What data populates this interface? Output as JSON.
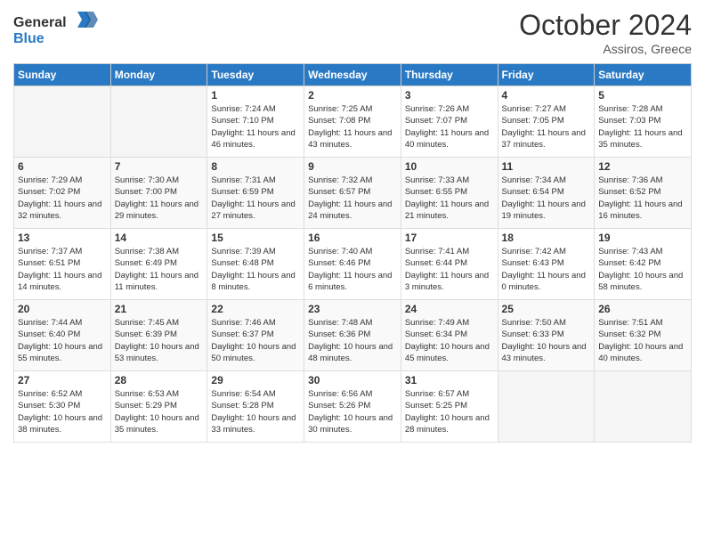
{
  "header": {
    "logo_line1": "General",
    "logo_line2": "Blue",
    "month": "October 2024",
    "location": "Assiros, Greece"
  },
  "weekdays": [
    "Sunday",
    "Monday",
    "Tuesday",
    "Wednesday",
    "Thursday",
    "Friday",
    "Saturday"
  ],
  "weeks": [
    [
      {
        "day": "",
        "info": ""
      },
      {
        "day": "",
        "info": ""
      },
      {
        "day": "1",
        "info": "Sunrise: 7:24 AM\nSunset: 7:10 PM\nDaylight: 11 hours and 46 minutes."
      },
      {
        "day": "2",
        "info": "Sunrise: 7:25 AM\nSunset: 7:08 PM\nDaylight: 11 hours and 43 minutes."
      },
      {
        "day": "3",
        "info": "Sunrise: 7:26 AM\nSunset: 7:07 PM\nDaylight: 11 hours and 40 minutes."
      },
      {
        "day": "4",
        "info": "Sunrise: 7:27 AM\nSunset: 7:05 PM\nDaylight: 11 hours and 37 minutes."
      },
      {
        "day": "5",
        "info": "Sunrise: 7:28 AM\nSunset: 7:03 PM\nDaylight: 11 hours and 35 minutes."
      }
    ],
    [
      {
        "day": "6",
        "info": "Sunrise: 7:29 AM\nSunset: 7:02 PM\nDaylight: 11 hours and 32 minutes."
      },
      {
        "day": "7",
        "info": "Sunrise: 7:30 AM\nSunset: 7:00 PM\nDaylight: 11 hours and 29 minutes."
      },
      {
        "day": "8",
        "info": "Sunrise: 7:31 AM\nSunset: 6:59 PM\nDaylight: 11 hours and 27 minutes."
      },
      {
        "day": "9",
        "info": "Sunrise: 7:32 AM\nSunset: 6:57 PM\nDaylight: 11 hours and 24 minutes."
      },
      {
        "day": "10",
        "info": "Sunrise: 7:33 AM\nSunset: 6:55 PM\nDaylight: 11 hours and 21 minutes."
      },
      {
        "day": "11",
        "info": "Sunrise: 7:34 AM\nSunset: 6:54 PM\nDaylight: 11 hours and 19 minutes."
      },
      {
        "day": "12",
        "info": "Sunrise: 7:36 AM\nSunset: 6:52 PM\nDaylight: 11 hours and 16 minutes."
      }
    ],
    [
      {
        "day": "13",
        "info": "Sunrise: 7:37 AM\nSunset: 6:51 PM\nDaylight: 11 hours and 14 minutes."
      },
      {
        "day": "14",
        "info": "Sunrise: 7:38 AM\nSunset: 6:49 PM\nDaylight: 11 hours and 11 minutes."
      },
      {
        "day": "15",
        "info": "Sunrise: 7:39 AM\nSunset: 6:48 PM\nDaylight: 11 hours and 8 minutes."
      },
      {
        "day": "16",
        "info": "Sunrise: 7:40 AM\nSunset: 6:46 PM\nDaylight: 11 hours and 6 minutes."
      },
      {
        "day": "17",
        "info": "Sunrise: 7:41 AM\nSunset: 6:44 PM\nDaylight: 11 hours and 3 minutes."
      },
      {
        "day": "18",
        "info": "Sunrise: 7:42 AM\nSunset: 6:43 PM\nDaylight: 11 hours and 0 minutes."
      },
      {
        "day": "19",
        "info": "Sunrise: 7:43 AM\nSunset: 6:42 PM\nDaylight: 10 hours and 58 minutes."
      }
    ],
    [
      {
        "day": "20",
        "info": "Sunrise: 7:44 AM\nSunset: 6:40 PM\nDaylight: 10 hours and 55 minutes."
      },
      {
        "day": "21",
        "info": "Sunrise: 7:45 AM\nSunset: 6:39 PM\nDaylight: 10 hours and 53 minutes."
      },
      {
        "day": "22",
        "info": "Sunrise: 7:46 AM\nSunset: 6:37 PM\nDaylight: 10 hours and 50 minutes."
      },
      {
        "day": "23",
        "info": "Sunrise: 7:48 AM\nSunset: 6:36 PM\nDaylight: 10 hours and 48 minutes."
      },
      {
        "day": "24",
        "info": "Sunrise: 7:49 AM\nSunset: 6:34 PM\nDaylight: 10 hours and 45 minutes."
      },
      {
        "day": "25",
        "info": "Sunrise: 7:50 AM\nSunset: 6:33 PM\nDaylight: 10 hours and 43 minutes."
      },
      {
        "day": "26",
        "info": "Sunrise: 7:51 AM\nSunset: 6:32 PM\nDaylight: 10 hours and 40 minutes."
      }
    ],
    [
      {
        "day": "27",
        "info": "Sunrise: 6:52 AM\nSunset: 5:30 PM\nDaylight: 10 hours and 38 minutes."
      },
      {
        "day": "28",
        "info": "Sunrise: 6:53 AM\nSunset: 5:29 PM\nDaylight: 10 hours and 35 minutes."
      },
      {
        "day": "29",
        "info": "Sunrise: 6:54 AM\nSunset: 5:28 PM\nDaylight: 10 hours and 33 minutes."
      },
      {
        "day": "30",
        "info": "Sunrise: 6:56 AM\nSunset: 5:26 PM\nDaylight: 10 hours and 30 minutes."
      },
      {
        "day": "31",
        "info": "Sunrise: 6:57 AM\nSunset: 5:25 PM\nDaylight: 10 hours and 28 minutes."
      },
      {
        "day": "",
        "info": ""
      },
      {
        "day": "",
        "info": ""
      }
    ]
  ]
}
